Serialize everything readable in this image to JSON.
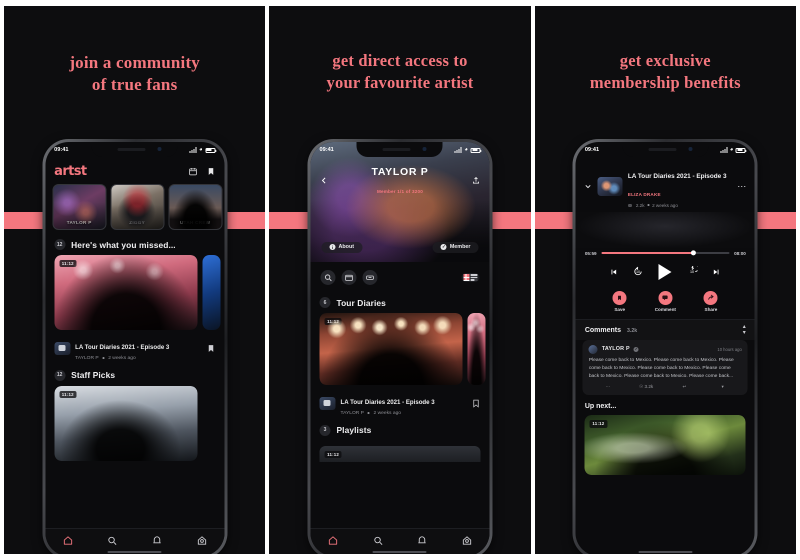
{
  "panels": [
    {
      "headline_line1": "join a community",
      "headline_line2": "of true fans",
      "status": {
        "time": "09:41"
      },
      "app": {
        "logo": "artst",
        "icons": [
          "calendar-icon",
          "bookmark-icon"
        ]
      },
      "stories": [
        {
          "caption": "TAYLOR P"
        },
        {
          "caption": "ZIGGY"
        },
        {
          "caption": "UTAH CREW"
        }
      ],
      "sections": [
        {
          "badge": "12",
          "title": "Here's what you missed..."
        },
        {
          "badge": "12",
          "title": "Staff Picks"
        }
      ],
      "featured": {
        "duration": "11:12",
        "title": "LA Tour Diaries 2021 - Episode 3",
        "artist": "TAYLOR P",
        "age": "2 weeks ago"
      },
      "staff_pick": {
        "duration": "11:12"
      },
      "tabs": [
        "home-icon",
        "search-icon",
        "bell-icon",
        "profile-icon"
      ]
    },
    {
      "headline_line1": "get direct access to",
      "headline_line2": "your favourite artist",
      "status": {
        "time": "09:41"
      },
      "hero": {
        "back": "back-arrow-icon",
        "name": "TAYLOR P",
        "subtitle": "Member 1/1 of 3200",
        "share": "share-icon",
        "about_label": "About",
        "member_label": "Member"
      },
      "tools": [
        "search-icon",
        "calendar-icon",
        "ticket-icon"
      ],
      "view_toggle": {
        "grid": "grid-view-icon",
        "list": "list-view-icon"
      },
      "sections": [
        {
          "badge": "6",
          "title": "Tour Diaries"
        },
        {
          "badge": "3",
          "title": "Playlists"
        }
      ],
      "featured": {
        "duration": "11:12",
        "title": "LA Tour Diaries 2021 - Episode 3",
        "artist": "TAYLOR P",
        "age": "2 weeks ago"
      },
      "playlist": {
        "duration": "11:12"
      },
      "tabs": [
        "home-icon",
        "search-icon",
        "bell-icon",
        "profile-icon"
      ]
    },
    {
      "headline_line1": "get exclusive",
      "headline_line2": "membership benefits",
      "status": {
        "time": "09:41"
      },
      "now_playing": {
        "title": "LA Tour Diaries 2021 - Episode 3",
        "artist": "ELIZA DRAKE",
        "views": "2.2k",
        "age": "2 weeks ago",
        "more": "more-options-icon"
      },
      "progress": {
        "elapsed": "05:59",
        "total": "08:00",
        "percent": 72
      },
      "controls": [
        "previous-icon",
        "rewind-10-icon",
        "play-icon",
        "forward-10-icon",
        "next-icon"
      ],
      "actions": [
        {
          "label": "Save",
          "icon": "bookmark-icon"
        },
        {
          "label": "Comment",
          "icon": "comment-icon"
        },
        {
          "label": "Share",
          "icon": "share-icon"
        }
      ],
      "comments": {
        "header": "Comments",
        "count": "3.2k",
        "item": {
          "name": "TAYLOR P",
          "verified": "✓",
          "timestamp": "10 hours ago",
          "body": "Please come back to Mexico. Please come back to Mexico. Please come back to Mexico. Please come back to Mexico. Please come back to Mexico. Please come back to Mexico. Please come back...",
          "likes": "3.2k"
        }
      },
      "up_next": {
        "header": "Up next...",
        "duration": "11:12"
      }
    }
  ],
  "theme": {
    "accent": "#f4777f",
    "panel_bg": "#0d0d0f",
    "page_bg": "#ffffff"
  }
}
